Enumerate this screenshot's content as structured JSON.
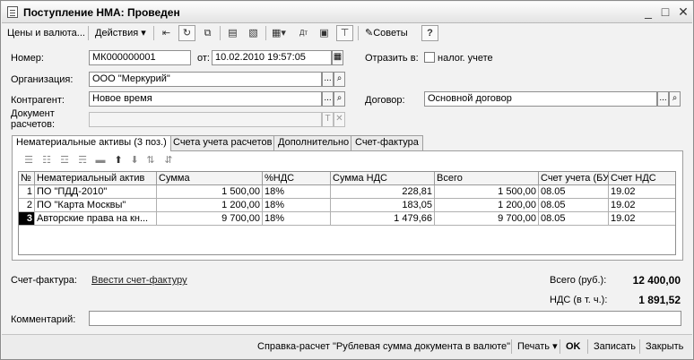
{
  "window": {
    "title": "Поступление НМА: Проведен",
    "minimize": "_",
    "maximize": "□",
    "close": "✕"
  },
  "toolbar": {
    "prices_label": "Цены и валюта...",
    "actions_label": "Действия",
    "tips_label": "Советы",
    "help_label": "?"
  },
  "form": {
    "number_label": "Номер:",
    "number_value": "МК000000001",
    "from_label": "от:",
    "date_value": "10.02.2010 19:57:05",
    "reflect_label": "Отразить в:",
    "tax_label": "налог. учете",
    "org_label": "Организация:",
    "org_value": "ООО \"Меркурий\"",
    "contractor_label": "Контрагент:",
    "contractor_value": "Новое время",
    "contract_label": "Договор:",
    "contract_value": "Основной договор",
    "settlement_label_1": "Документ",
    "settlement_label_2": "расчетов:",
    "settlement_value": ""
  },
  "tabs": [
    {
      "label": "Нематериальные активы (3 поз.)"
    },
    {
      "label": "Счета учета расчетов"
    },
    {
      "label": "Дополнительно"
    },
    {
      "label": "Счет-фактура"
    }
  ],
  "grid": {
    "columns": [
      "№",
      "Нематериальный актив",
      "Сумма",
      "%НДС",
      "Сумма НДС",
      "Всего",
      "Счет учета (БУ)",
      "Счет НДС"
    ],
    "rows": [
      {
        "n": "1",
        "asset": "ПО \"ПДД-2010\"",
        "sum": "1 500,00",
        "vat_rate": "18%",
        "vat_sum": "228,81",
        "total": "1 500,00",
        "account": "08.05",
        "vat_account": "19.02"
      },
      {
        "n": "2",
        "asset": "ПО \"Карта Москвы\"",
        "sum": "1 200,00",
        "vat_rate": "18%",
        "vat_sum": "183,05",
        "total": "1 200,00",
        "account": "08.05",
        "vat_account": "19.02"
      },
      {
        "n": "3",
        "asset": "Авторские права на кн...",
        "sum": "9 700,00",
        "vat_rate": "18%",
        "vat_sum": "1 479,66",
        "total": "9 700,00",
        "account": "08.05",
        "vat_account": "19.02"
      }
    ]
  },
  "footer": {
    "invoice_label": "Счет-фактура:",
    "invoice_link": "Ввести счет-фактуру",
    "total_label": "Всего (руб.):",
    "total_value": "12 400,00",
    "vat_label": "НДС (в т. ч.):",
    "vat_value": "1 891,52",
    "comment_label": "Комментарий:",
    "comment_value": ""
  },
  "bottom": {
    "report_label": "Справка-расчет \"Рублевая сумма документа в валюте\"",
    "print_label": "Печать",
    "ok_label": "OK",
    "save_label": "Записать",
    "close_label": "Закрыть"
  }
}
